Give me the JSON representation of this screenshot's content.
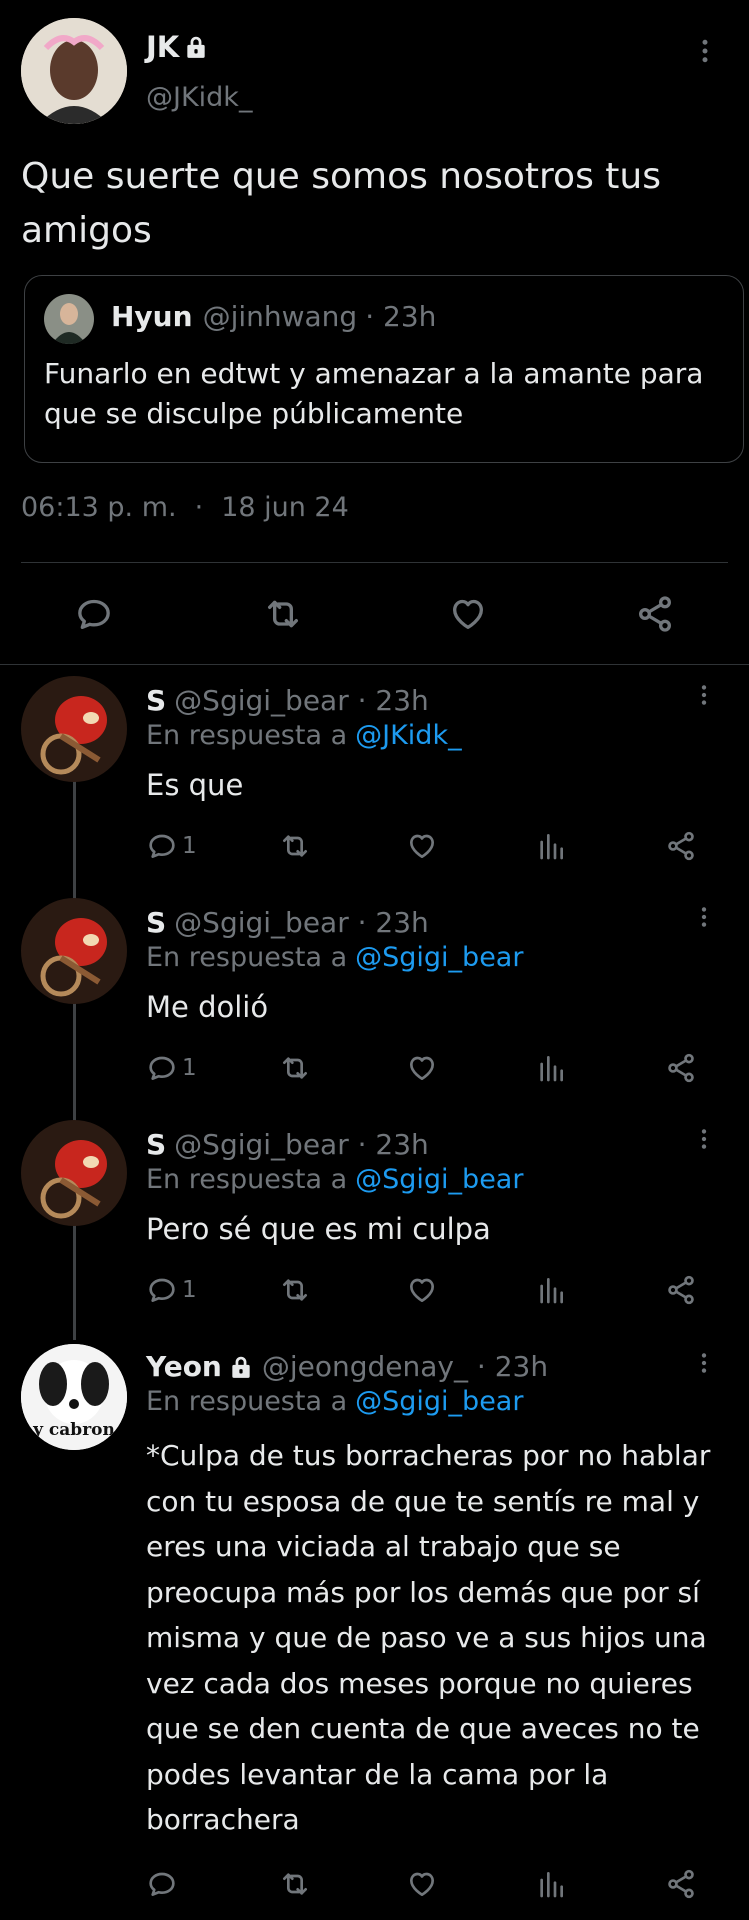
{
  "main_tweet": {
    "display_name": "JK",
    "handle": "@JKidk_",
    "text_line1": "Que suerte que somos nosotros tus",
    "text_line2": "amigos",
    "time": "06:13 p. m.",
    "dot": "·",
    "date": "18 jun 24",
    "quoted": {
      "display_name": "Hyun",
      "handle": "@jinhwang",
      "time": "· 23h",
      "text_line1": "Funarlo en edtwt y amenazar a la amante para",
      "text_line2": "que se disculpe públicamente"
    }
  },
  "replies": [
    {
      "display_name": "S",
      "handle_time": "@Sgigi_bear · 23h",
      "reply_prefix": "En respuesta a",
      "reply_to": "@JKidk_",
      "text": "Es que",
      "reply_count": "1"
    },
    {
      "display_name": "S",
      "handle_time": "@Sgigi_bear · 23h",
      "reply_prefix": "En respuesta a",
      "reply_to": "@Sgigi_bear",
      "text": "Me dolió",
      "reply_count": "1"
    },
    {
      "display_name": "S",
      "handle_time": "@Sgigi_bear · 23h",
      "reply_prefix": "En respuesta a",
      "reply_to": "@Sgigi_bear",
      "text": "Pero sé que es mi culpa",
      "reply_count": "1"
    },
    {
      "display_name": "Yeon",
      "handle_time": "@jeongdenay_ · 23h",
      "reply_prefix": "En respuesta a",
      "reply_to": "@Sgigi_bear",
      "avatar_text": "y cabron",
      "lines": [
        "*Culpa de tus borracheras por no hablar",
        "con tu esposa de que te sentís re mal y",
        "eres una viciada al trabajo que se",
        "preocupa más por los demás que por sí",
        "misma y que de paso ve a sus hijos una",
        "vez cada dos meses porque no quieres",
        "que se den cuenta de que aveces no te",
        "podes levantar de la cama por la",
        "borrachera"
      ]
    }
  ],
  "colors": {
    "background": "#000000",
    "text": "#e7e9ea",
    "muted": "#71767b",
    "link": "#1d9bf0",
    "separator": "#2f3336"
  }
}
